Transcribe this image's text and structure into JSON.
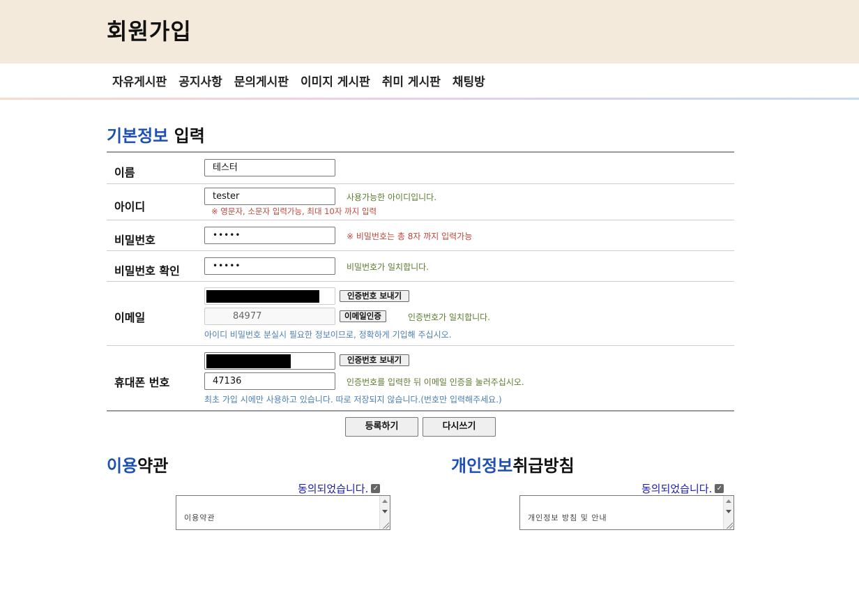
{
  "header": {
    "title": "회원가입"
  },
  "nav": {
    "items": [
      "자유게시판",
      "공지사항",
      "문의게시판",
      "이미지 게시판",
      "취미 게시판",
      "채팅방"
    ]
  },
  "basic_info": {
    "title_highlight": "기본정보",
    "title_rest": " 입력",
    "name": {
      "label": "이름",
      "value": "테스터"
    },
    "id": {
      "label": "아이디",
      "value": "tester",
      "status": "사용가능한 아이디입니다.",
      "hint": "※ 영문자, 소문자 입력가능, 최대 10자 까지 입력"
    },
    "password": {
      "label": "비밀번호",
      "value": "•••••",
      "hint": "※ 비밀번호는 총 8자 까지 입력가능"
    },
    "password_confirm": {
      "label": "비밀번호 확인",
      "value": "•••••",
      "status": "비밀번호가 일치합니다."
    },
    "email": {
      "label": "이메일",
      "send_button": "인증번호 보내기",
      "code_value": "84977",
      "verify_button": "이메일인증",
      "status": "인증번호가 일치합니다.",
      "info": "아이디 비밀번호 분실시 필요한 정보이므로, 정확하게 기입해 주십시오."
    },
    "phone": {
      "label": "휴대폰 번호",
      "send_button": "인증번호 보내기",
      "code_value": "47136",
      "status": "인증번호를 입력한 뒤 이메일 인증을 눌러주십시오.",
      "info": "최초 가입 시에만 사용하고 있습니다. 따로 저장되지 않습니다.(번호만 입력해주세요.)"
    }
  },
  "actions": {
    "submit": "등록하기",
    "reset": "다시쓰기"
  },
  "terms": {
    "title_highlight": "이용",
    "title_rest": "약관",
    "agree_label": "동의되었습니다.",
    "checked": true,
    "content": "이용약관"
  },
  "privacy": {
    "title_highlight": "개인정보",
    "title_rest": "취급방침",
    "agree_label": "동의되었습니다.",
    "checked": true,
    "content": "개인정보 방침 및 안내"
  },
  "colors": {
    "accent": "#1d4fb5",
    "header_bg": "#f3eadb",
    "ok": "#5b7a2c",
    "warn": "#c0473a",
    "info": "#4b7fb3"
  }
}
